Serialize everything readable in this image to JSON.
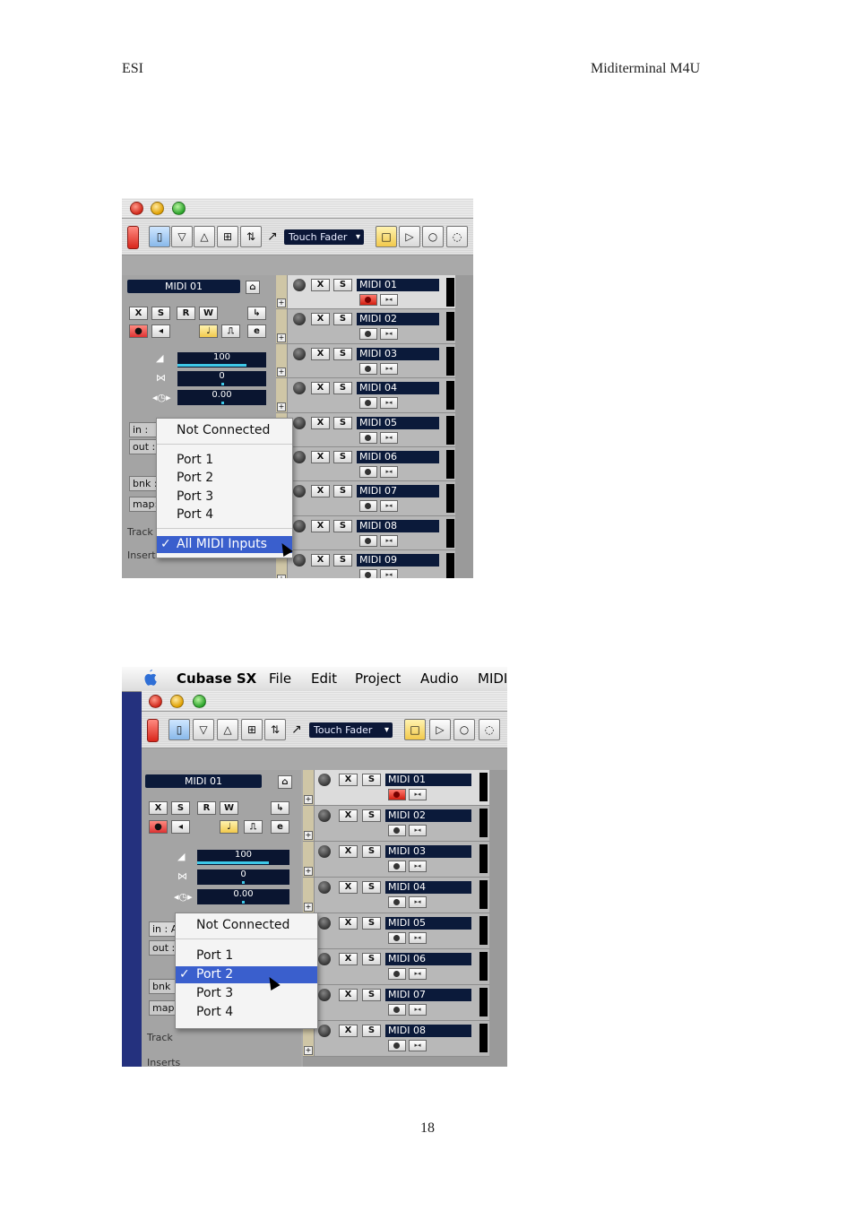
{
  "header": {
    "left": "ESI",
    "right": "Miditerminal M4U"
  },
  "page_number": "18",
  "screens": [
    {
      "fader_mode": "Touch Fader",
      "selected_track": "MIDI 01",
      "volume": "100",
      "pan": "0",
      "delay": "0.00",
      "labels": {
        "in": "in :",
        "out": "out :",
        "bnk": "bnk :",
        "map": "map:",
        "track": "Track",
        "inserts": "Inserts"
      },
      "buttons": {
        "x": "X",
        "s": "S",
        "r": "R",
        "w": "W",
        "e": "e"
      },
      "tracks": [
        "MIDI 01",
        "MIDI 02",
        "MIDI 03",
        "MIDI 04",
        "MIDI 05",
        "MIDI 06",
        "MIDI 07",
        "MIDI 08",
        "MIDI 09"
      ],
      "popup": {
        "items": [
          "Not Connected",
          "Port 1",
          "Port 2",
          "Port 3",
          "Port 4",
          "All MIDI Inputs"
        ],
        "checked": "All MIDI Inputs"
      }
    },
    {
      "menubar": {
        "app": "Cubase SX",
        "items": [
          "File",
          "Edit",
          "Project",
          "Audio",
          "MIDI"
        ]
      },
      "fader_mode": "Touch Fader",
      "selected_track": "MIDI 01",
      "volume": "100",
      "pan": "0",
      "delay": "0.00",
      "labels": {
        "in": "in : All MIDI Inputs",
        "out": "out :",
        "bnk": "bnk :",
        "map": "map:",
        "track": "Track",
        "inserts": "Inserts"
      },
      "buttons": {
        "x": "X",
        "s": "S",
        "r": "R",
        "w": "W",
        "e": "e"
      },
      "tracks": [
        "MIDI 01",
        "MIDI 02",
        "MIDI 03",
        "MIDI 04",
        "MIDI 05",
        "MIDI 06",
        "MIDI 07",
        "MIDI 08"
      ],
      "popup": {
        "items": [
          "Not Connected",
          "Port 1",
          "Port 2",
          "Port 3",
          "Port 4"
        ],
        "checked": "Port 2"
      }
    }
  ]
}
